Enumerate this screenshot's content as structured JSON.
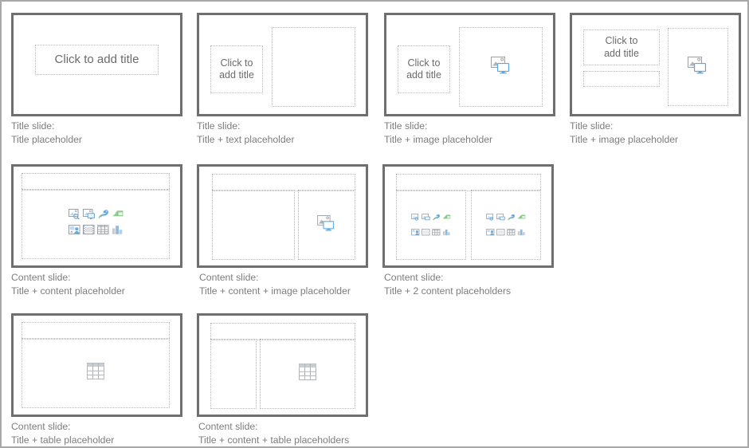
{
  "page": {
    "title": "Slide layout gallery",
    "border_color": "#a8a8a8",
    "thumb_border_color": "#6f6f6f",
    "placeholder_border_color": "#b9b9b9",
    "caption_color": "#7d7d7d",
    "title_text_color": "#6b6b6b",
    "accent_blue": "#7ab8e8",
    "accent_green": "#8cc98c"
  },
  "placeholder_prompt": {
    "full": "Click to add title",
    "line1": "Click to",
    "line2": "add title"
  },
  "icons": {
    "image_placeholder": "image-placeholder-icon",
    "table_placeholder": "table-placeholder-icon",
    "content_icons": [
      "insert-picture-icon",
      "insert-screenshot-icon",
      "insert-stock-image-icon",
      "insert-smartart-icon",
      "insert-icon-icon",
      "insert-video-icon",
      "insert-table-icon",
      "insert-chart-icon"
    ]
  },
  "slides": [
    {
      "id": "title-placeholder",
      "caption_line1": "Title slide:",
      "caption_line2": "Title placeholder",
      "kind": "title-only"
    },
    {
      "id": "title-text-placeholder",
      "caption_line1": "Title slide:",
      "caption_line2": "Title + text placeholder",
      "kind": "title-text"
    },
    {
      "id": "title-image-placeholder",
      "caption_line1": "Title slide:",
      "caption_line2": "Title + image placeholder",
      "kind": "title-image"
    },
    {
      "id": "title-subtitle-image-placeholder",
      "caption_line1": "Title slide:",
      "caption_line2": "Title + image placeholder",
      "kind": "title-subtitle-image"
    },
    {
      "id": "content-placeholder",
      "caption_line1": "Content slide:",
      "caption_line2": "Title + content placeholder",
      "kind": "content"
    },
    {
      "id": "content-image-placeholder",
      "caption_line1": "Content slide:",
      "caption_line2": "Title + content + image placeholder",
      "kind": "content-image"
    },
    {
      "id": "two-content-placeholders",
      "caption_line1": "Content slide:",
      "caption_line2": "Title + 2 content placeholders",
      "kind": "two-content"
    },
    {
      "id": "table-placeholder",
      "caption_line1": "Content slide:",
      "caption_line2": "Title + table placeholder",
      "kind": "table"
    },
    {
      "id": "content-table-placeholders",
      "caption_line1": "Content slide:",
      "caption_line2": "Title + content + table placeholders",
      "kind": "content-table"
    }
  ]
}
